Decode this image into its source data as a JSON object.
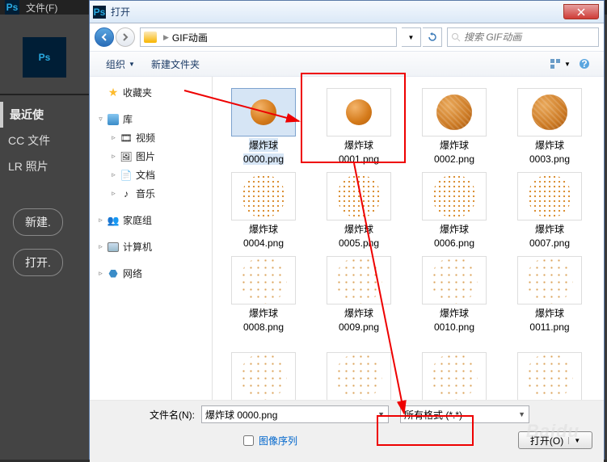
{
  "ps": {
    "menu_file": "文件(F)",
    "logo": "Ps",
    "recent_hdr": "最近使",
    "side1": "CC 文件",
    "side2": "LR 照片",
    "btn_new": "新建.",
    "btn_open": "打开."
  },
  "dialog": {
    "title": "打开",
    "breadcrumb": "GIF动画",
    "search_ph": "搜索 GIF动画",
    "organize": "组织",
    "new_folder": "新建文件夹",
    "filename_label": "文件名(N):",
    "filename_value": "爆炸球 0000.png",
    "filetype": "所有格式 (*.*)",
    "seq_label": "图像序列",
    "open_btn": "打开(O)"
  },
  "tree": {
    "fav": "收藏夹",
    "lib": "库",
    "video": "视频",
    "pic": "图片",
    "doc": "文档",
    "music": "音乐",
    "home": "家庭组",
    "computer": "计算机",
    "network": "网络"
  },
  "files": [
    {
      "name": "爆炸球",
      "ext": "0000.png",
      "t": "solid",
      "sel": true
    },
    {
      "name": "爆炸球",
      "ext": "0001.png",
      "t": "solid"
    },
    {
      "name": "爆炸球",
      "ext": "0002.png",
      "t": "tex"
    },
    {
      "name": "爆炸球",
      "ext": "0003.png",
      "t": "tex"
    },
    {
      "name": "爆炸球",
      "ext": "0004.png",
      "t": "dots"
    },
    {
      "name": "爆炸球",
      "ext": "0005.png",
      "t": "dots"
    },
    {
      "name": "爆炸球",
      "ext": "0006.png",
      "t": "dots"
    },
    {
      "name": "爆炸球",
      "ext": "0007.png",
      "t": "dots"
    },
    {
      "name": "爆炸球",
      "ext": "0008.png",
      "t": "sparse"
    },
    {
      "name": "爆炸球",
      "ext": "0009.png",
      "t": "sparse"
    },
    {
      "name": "爆炸球",
      "ext": "0010.png",
      "t": "sparse"
    },
    {
      "name": "爆炸球",
      "ext": "0011.png",
      "t": "sparse"
    },
    {
      "name": "",
      "ext": "",
      "t": "sparse"
    },
    {
      "name": "",
      "ext": "",
      "t": "sparse"
    },
    {
      "name": "",
      "ext": "",
      "t": "sparse"
    },
    {
      "name": "",
      "ext": "",
      "t": "sparse"
    }
  ]
}
